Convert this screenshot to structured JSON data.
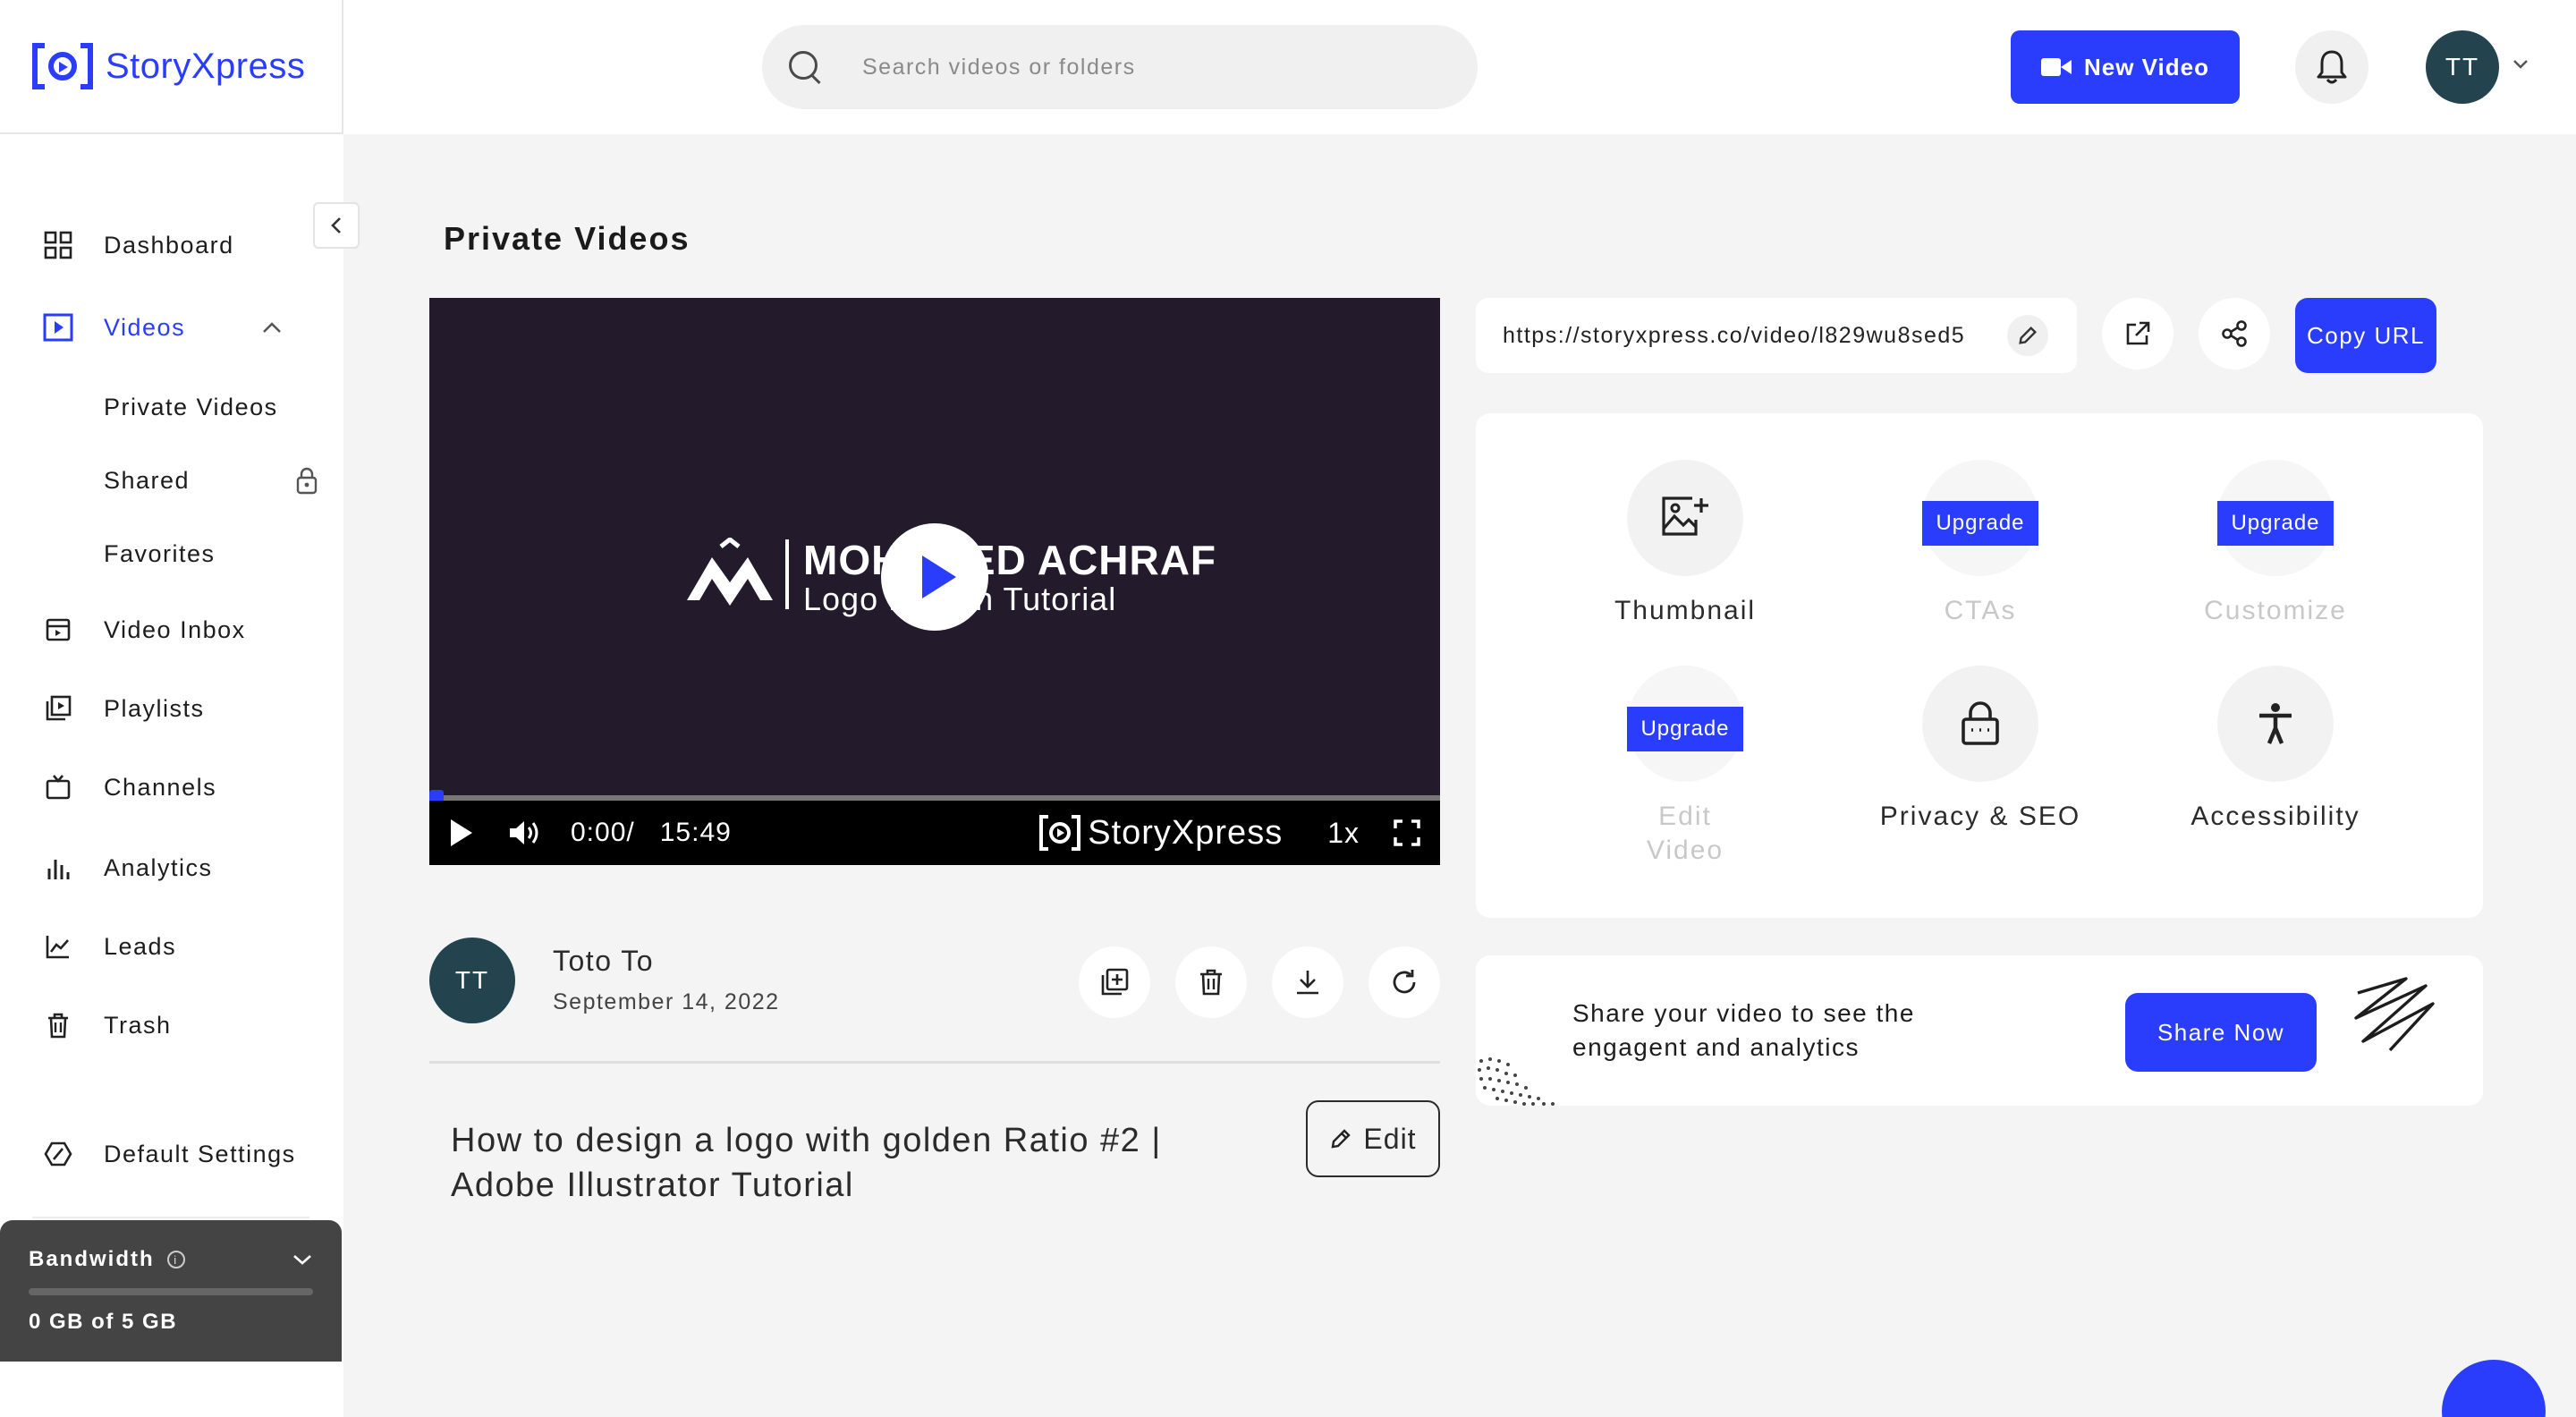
{
  "app": {
    "brand": "StoryXpress"
  },
  "header": {
    "search_placeholder": "Search videos or folders",
    "new_video_label": "New Video",
    "user_initials": "TT"
  },
  "sidebar": {
    "items": [
      {
        "label": "Dashboard",
        "icon": "grid-icon"
      },
      {
        "label": "Videos",
        "icon": "play-square-icon",
        "active": true
      },
      {
        "label": "Private Videos"
      },
      {
        "label": "Shared"
      },
      {
        "label": "Favorites"
      },
      {
        "label": "Video Inbox",
        "icon": "inbox-icon"
      },
      {
        "label": "Playlists",
        "icon": "playlist-icon"
      },
      {
        "label": "Channels",
        "icon": "tv-icon"
      },
      {
        "label": "Analytics",
        "icon": "bar-chart-icon"
      },
      {
        "label": "Leads",
        "icon": "line-chart-icon"
      },
      {
        "label": "Trash",
        "icon": "trash-icon"
      },
      {
        "label": "Default Settings",
        "icon": "settings-icon"
      }
    ],
    "bandwidth": {
      "title": "Bandwidth",
      "info": "i",
      "usage_text": "0 GB of 5 GB",
      "used_fraction": 0.0
    }
  },
  "main": {
    "page_title": "Private Videos",
    "player": {
      "brand_name": "MOHAMED ACHRAF",
      "brand_sub": "Logo Design Tutorial",
      "current_time": "0:00/",
      "duration": "15:49",
      "watermark": "StoryXpress",
      "speed": "1x",
      "progress_fraction": 0.0
    },
    "owner": {
      "initials": "TT",
      "name": "Toto To",
      "date": "September 14, 2022"
    },
    "video_title": "How to design a logo with golden Ratio #2 | Adobe Illustrator Tutorial",
    "edit_label": "Edit"
  },
  "right": {
    "url": "https://storyxpress.co/video/l829wu8sed5",
    "copy_label": "Copy URL",
    "features": [
      {
        "label": "Thumbnail",
        "icon": "image-add-icon",
        "disabled": false
      },
      {
        "label": "CTAs",
        "icon": "cta-icon",
        "disabled": true,
        "badge": "Upgrade"
      },
      {
        "label": "Customize",
        "icon": "customize-icon",
        "disabled": true,
        "badge": "Upgrade"
      },
      {
        "label": "Edit\nVideo",
        "icon": "scissors-icon",
        "disabled": true,
        "badge": "Upgrade"
      },
      {
        "label": "Privacy & SEO",
        "icon": "lock-icon",
        "disabled": false
      },
      {
        "label": "Accessibility",
        "icon": "accessibility-icon",
        "disabled": false
      }
    ],
    "share": {
      "text": "Share your video to see the engagent and analytics",
      "button_label": "Share Now"
    }
  },
  "colors": {
    "accent": "#2a3dfc",
    "avatar": "#23434f",
    "sidebar_footer": "#444444"
  }
}
